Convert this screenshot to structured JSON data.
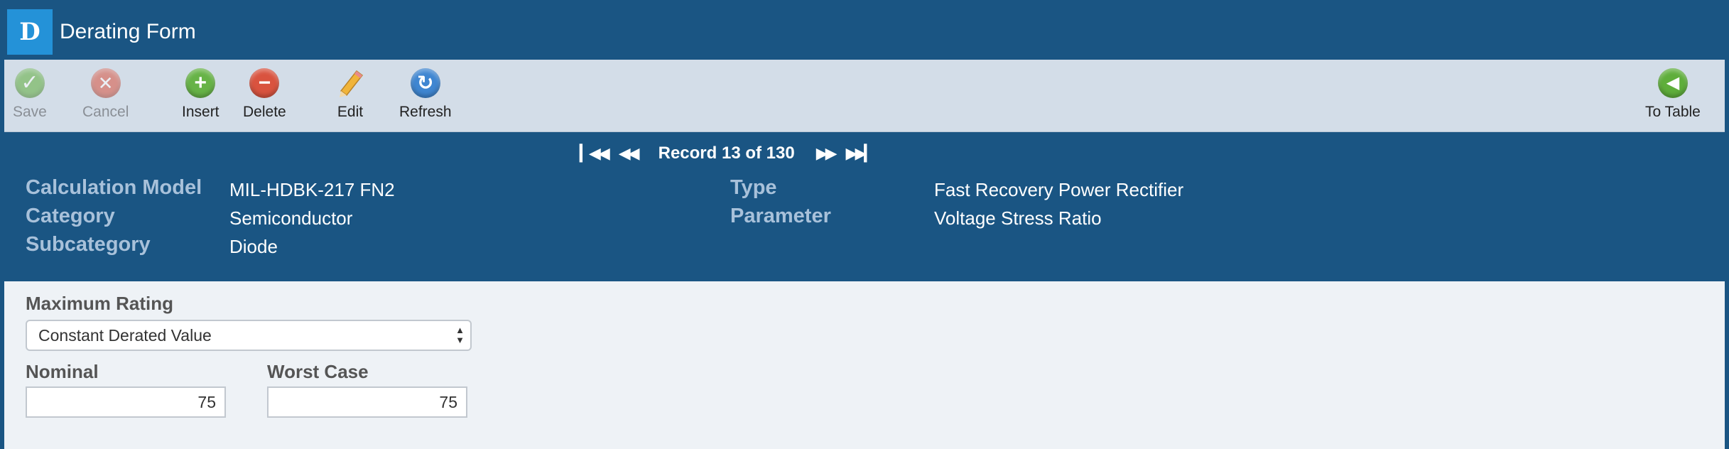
{
  "app": {
    "logo": "D",
    "title": "Derating Form"
  },
  "toolbar": {
    "save": "Save",
    "cancel": "Cancel",
    "insert": "Insert",
    "delete": "Delete",
    "edit": "Edit",
    "refresh": "Refresh",
    "to_table": "To Table"
  },
  "nav": {
    "record": "Record 13 of 130"
  },
  "fields": {
    "calc_model_label": "Calculation Model",
    "calc_model_value": "MIL-HDBK-217 FN2",
    "category_label": "Category",
    "category_value": "Semiconductor",
    "subcategory_label": "Subcategory",
    "subcategory_value": "Diode",
    "type_label": "Type",
    "type_value": "Fast Recovery Power Rectifier",
    "parameter_label": "Parameter",
    "parameter_value": "Voltage Stress Ratio"
  },
  "form": {
    "max_rating_label": "Maximum Rating",
    "max_rating_value": "Constant Derated Value",
    "nominal_label": "Nominal",
    "nominal_value": "75",
    "worst_case_label": "Worst Case",
    "worst_case_value": "75"
  },
  "colors": {
    "header_bg": "#1a5583",
    "toolbar_bg": "#d3dde8",
    "logo_bg": "#2492d8",
    "label_color": "#a8c1da"
  }
}
